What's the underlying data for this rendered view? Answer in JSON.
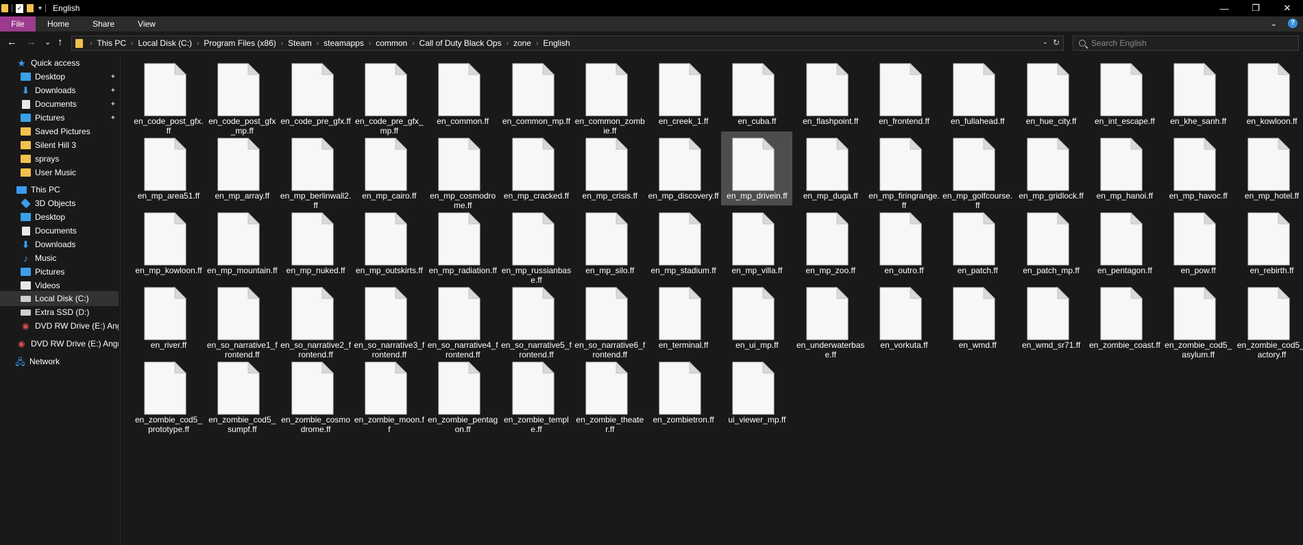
{
  "window": {
    "title": "English",
    "minimize": "—",
    "maximize": "❐",
    "close": "✕"
  },
  "ribbon": {
    "tabs": [
      "File",
      "Home",
      "Share",
      "View"
    ],
    "expand": "⌄",
    "help": "?"
  },
  "nav": {
    "back": "←",
    "forward": "→",
    "recent": "⌄",
    "up": "↑"
  },
  "address": {
    "crumbs": [
      "This PC",
      "Local Disk (C:)",
      "Program Files (x86)",
      "Steam",
      "steamapps",
      "common",
      "Call of Duty Black Ops",
      "zone",
      "English"
    ],
    "dropdown": "⌄",
    "refresh": "↻"
  },
  "search": {
    "placeholder": "Search English"
  },
  "sidebar": {
    "items": [
      {
        "label": "Quick access",
        "icon": "star-icon"
      },
      {
        "label": "Desktop",
        "icon": "desktop-folder-icon",
        "pinned": true
      },
      {
        "label": "Downloads",
        "icon": "download-icon",
        "pinned": true
      },
      {
        "label": "Documents",
        "icon": "document-icon",
        "pinned": true
      },
      {
        "label": "Pictures",
        "icon": "pictures-folder-icon",
        "pinned": true
      },
      {
        "label": "Saved Pictures",
        "icon": "folder-icon"
      },
      {
        "label": "Silent Hill 3",
        "icon": "folder-icon"
      },
      {
        "label": "sprays",
        "icon": "folder-icon"
      },
      {
        "label": "User Music",
        "icon": "folder-icon"
      },
      {
        "label": "This PC",
        "icon": "computer-icon"
      },
      {
        "label": "3D Objects",
        "icon": "3d-objects-icon"
      },
      {
        "label": "Desktop",
        "icon": "desktop-folder-icon"
      },
      {
        "label": "Documents",
        "icon": "document-icon"
      },
      {
        "label": "Downloads",
        "icon": "download-icon"
      },
      {
        "label": "Music",
        "icon": "music-icon"
      },
      {
        "label": "Pictures",
        "icon": "pictures-folder-icon"
      },
      {
        "label": "Videos",
        "icon": "video-icon"
      },
      {
        "label": "Local Disk (C:)",
        "icon": "drive-icon",
        "selected": true
      },
      {
        "label": "Extra SSD (D:)",
        "icon": "drive-icon"
      },
      {
        "label": "DVD RW Drive (E:) Angry",
        "icon": "dvd-icon"
      },
      {
        "label": "DVD RW Drive (E:) Angry",
        "icon": "dvd-icon"
      },
      {
        "label": "Network",
        "icon": "network-icon"
      }
    ],
    "pin_glyph": "📌"
  },
  "files": {
    "selected_index": 24,
    "items": [
      "en_code_post_gfx.ff",
      "en_code_post_gfx_mp.ff",
      "en_code_pre_gfx.ff",
      "en_code_pre_gfx_mp.ff",
      "en_common.ff",
      "en_common_mp.ff",
      "en_common_zombie.ff",
      "en_creek_1.ff",
      "en_cuba.ff",
      "en_flashpoint.ff",
      "en_frontend.ff",
      "en_fullahead.ff",
      "en_hue_city.ff",
      "en_int_escape.ff",
      "en_khe_sanh.ff",
      "en_kowloon.ff",
      "en_mp_area51.ff",
      "en_mp_array.ff",
      "en_mp_berlinwall2.ff",
      "en_mp_cairo.ff",
      "en_mp_cosmodrome.ff",
      "en_mp_cracked.ff",
      "en_mp_crisis.ff",
      "en_mp_discovery.ff",
      "en_mp_drivein.ff",
      "en_mp_duga.ff",
      "en_mp_firingrange.ff",
      "en_mp_golfcourse.ff",
      "en_mp_gridlock.ff",
      "en_mp_hanoi.ff",
      "en_mp_havoc.ff",
      "en_mp_hotel.ff",
      "en_mp_kowloon.ff",
      "en_mp_mountain.ff",
      "en_mp_nuked.ff",
      "en_mp_outskirts.ff",
      "en_mp_radiation.ff",
      "en_mp_russianbase.ff",
      "en_mp_silo.ff",
      "en_mp_stadium.ff",
      "en_mp_villa.ff",
      "en_mp_zoo.ff",
      "en_outro.ff",
      "en_patch.ff",
      "en_patch_mp.ff",
      "en_pentagon.ff",
      "en_pow.ff",
      "en_rebirth.ff",
      "en_river.ff",
      "en_so_narrative1_frontend.ff",
      "en_so_narrative2_frontend.ff",
      "en_so_narrative3_frontend.ff",
      "en_so_narrative4_frontend.ff",
      "en_so_narrative5_frontend.ff",
      "en_so_narrative6_frontend.ff",
      "en_terminal.ff",
      "en_ui_mp.ff",
      "en_underwaterbase.ff",
      "en_vorkuta.ff",
      "en_wmd.ff",
      "en_wmd_sr71.ff",
      "en_zombie_coast.ff",
      "en_zombie_cod5_asylum.ff",
      "en_zombie_cod5_factory.ff",
      "en_zombie_cod5_prototype.ff",
      "en_zombie_cod5_sumpf.ff",
      "en_zombie_cosmodrome.ff",
      "en_zombie_moon.ff",
      "en_zombie_pentagon.ff",
      "en_zombie_temple.ff",
      "en_zombie_theater.ff",
      "en_zombietron.ff",
      "ui_viewer_mp.ff"
    ]
  },
  "colors": {
    "file_tab": "#9c3b8d",
    "background": "#191919",
    "selection": "#4d4d4d",
    "accent": "#3a9bf0",
    "folder": "#f2c14e"
  }
}
